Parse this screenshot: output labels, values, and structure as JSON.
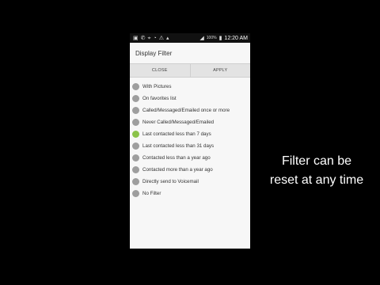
{
  "status_bar": {
    "battery": "100%",
    "time": "12:20 AM",
    "left_icons": [
      "notification-icon",
      "missed-call-icon",
      "location-icon",
      "wifi-icon",
      "alert-icon",
      "download-icon"
    ],
    "right_icons": [
      "signal-icon",
      "battery-icon"
    ]
  },
  "dialog": {
    "title": "Display Filter",
    "close_label": "CLOSE",
    "apply_label": "APPLY",
    "options": [
      {
        "label": "With Pictures",
        "selected": false
      },
      {
        "label": "On favorites list",
        "selected": false
      },
      {
        "label": "Called/Messaged/Emailed once or more",
        "selected": false
      },
      {
        "label": "Never Called/Messaged/Emailed",
        "selected": false
      },
      {
        "label": "Last contacted less than 7 days",
        "selected": true
      },
      {
        "label": "Last contacted less than 31 days",
        "selected": false
      },
      {
        "label": "Contacted less than a year ago",
        "selected": false
      },
      {
        "label": "Contacted more than a year ago",
        "selected": false
      },
      {
        "label": "Directly send to Voicemail",
        "selected": false
      },
      {
        "label": "No Filter",
        "selected": false
      }
    ]
  },
  "caption": {
    "line1": "Filter can be",
    "line2": "reset at any time"
  },
  "colors": {
    "selected_radio": "#8bc34a",
    "unselected_radio": "#9e9e9e"
  }
}
